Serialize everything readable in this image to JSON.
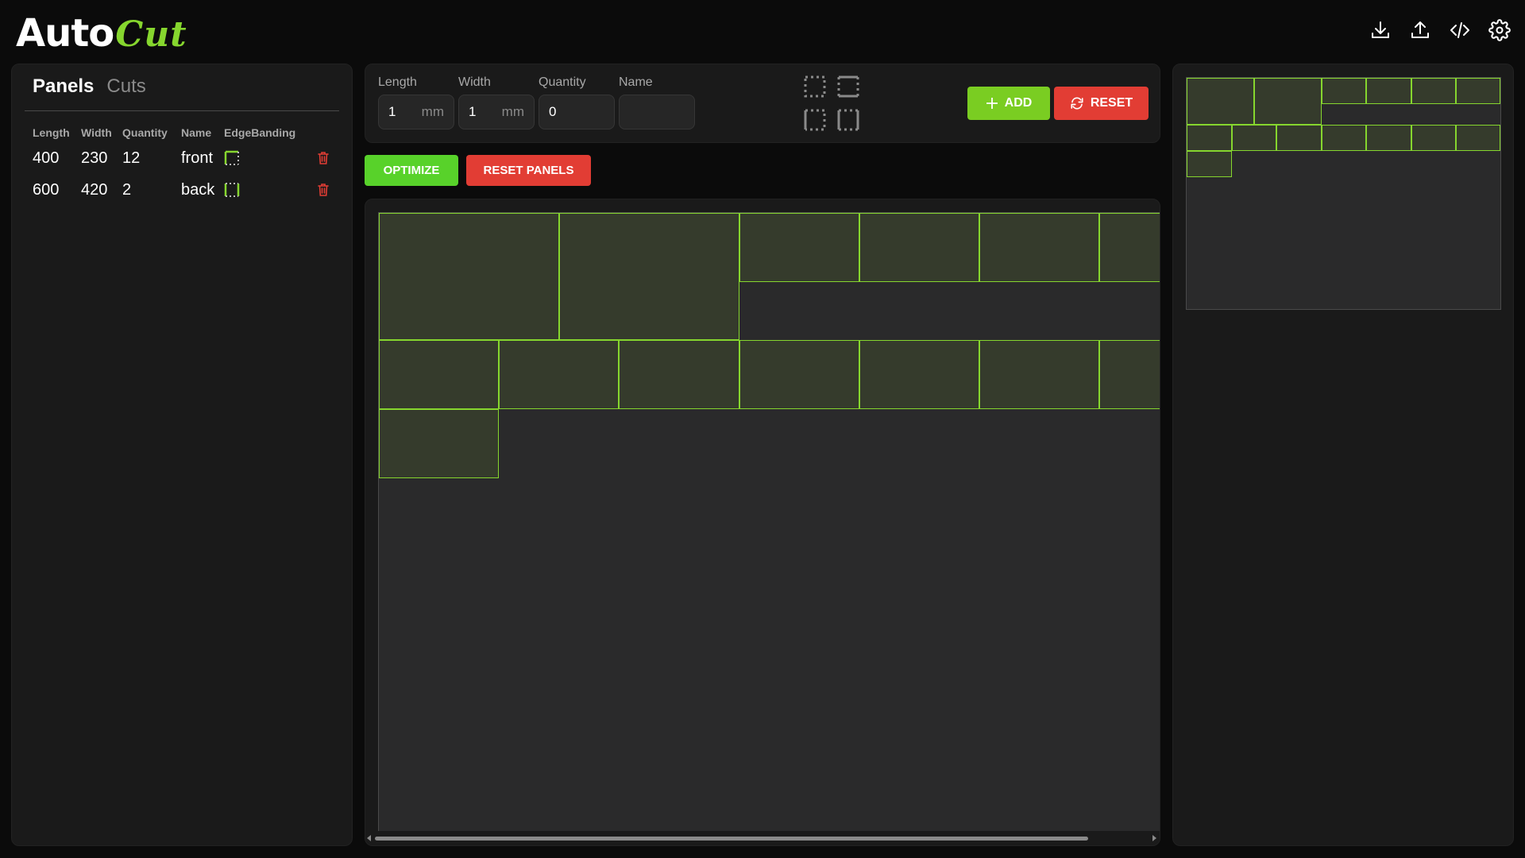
{
  "app": {
    "logo_auto": "Auto",
    "logo_cut": "Cut"
  },
  "header": {
    "icons": [
      "download-icon",
      "upload-icon",
      "code-icon",
      "gear-icon"
    ]
  },
  "sidebar": {
    "tabs": [
      {
        "label": "Panels",
        "active": true
      },
      {
        "label": "Cuts",
        "active": false
      }
    ],
    "table": {
      "headers": [
        "Length",
        "Width",
        "Quantity",
        "Name",
        "EdgeBanding"
      ],
      "rows": [
        {
          "length": "400",
          "width": "230",
          "quantity": "12",
          "name": "front"
        },
        {
          "length": "600",
          "width": "420",
          "quantity": "2",
          "name": "back"
        }
      ]
    }
  },
  "form": {
    "length_label": "Length",
    "length_value": "1",
    "length_unit": "mm",
    "width_label": "Width",
    "width_value": "1",
    "width_unit": "mm",
    "quantity_label": "Quantity",
    "quantity_value": "0",
    "name_label": "Name",
    "name_value": "",
    "add_label": "ADD",
    "reset_label": "RESET"
  },
  "actions": {
    "optimize_label": "OPTIMIZE",
    "reset_panels_label": "RESET PANELS"
  },
  "colors": {
    "accent": "#86d62e",
    "danger": "#e23d34",
    "piece_fill": "#353b2c",
    "sheet_bg": "#2a2a2b"
  }
}
